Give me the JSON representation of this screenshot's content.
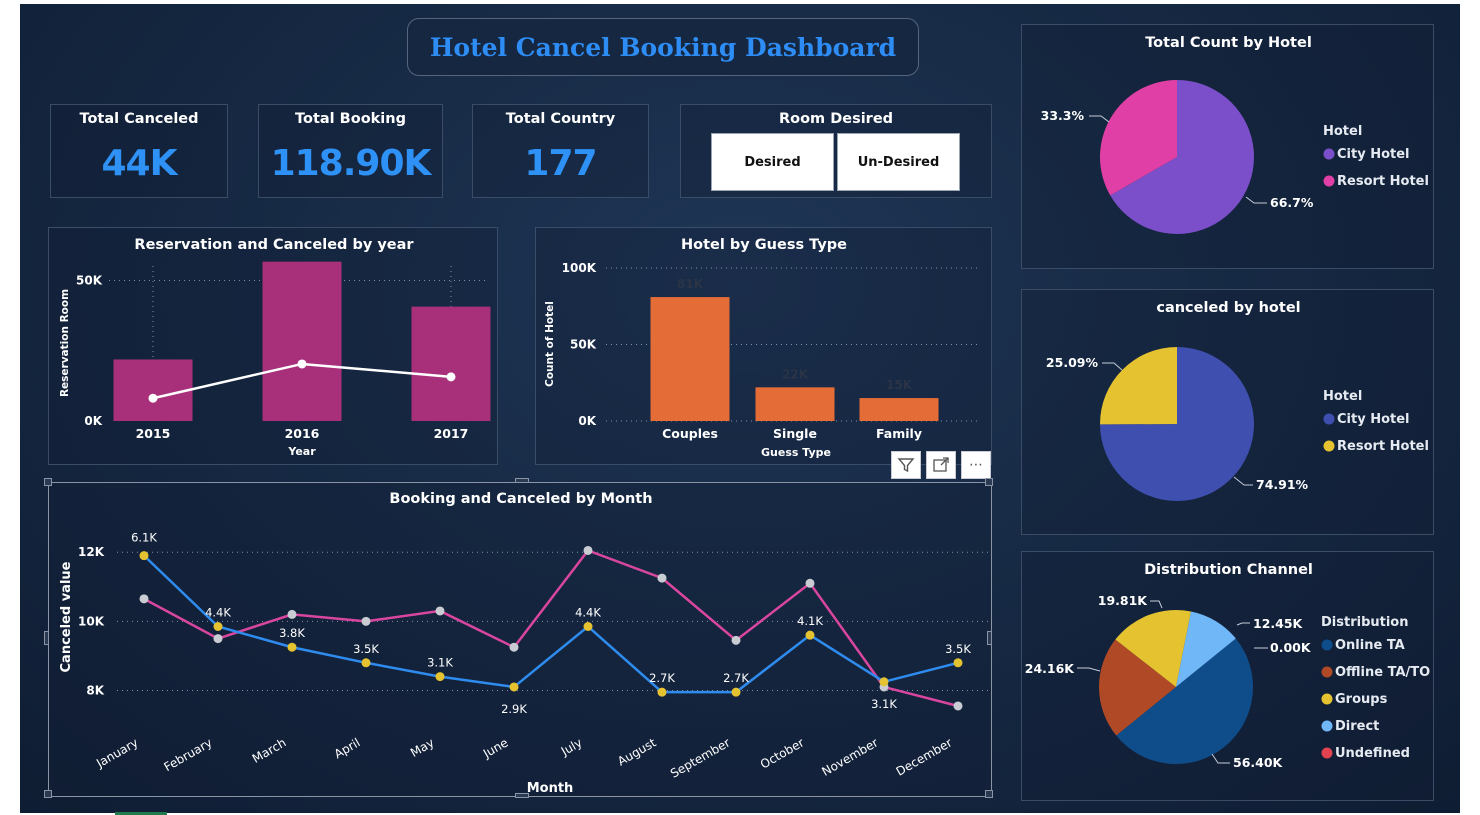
{
  "dashboard": {
    "title": "Hotel Cancel Booking Dashboard"
  },
  "kpis": [
    {
      "label": "Total Canceled",
      "value": "44K"
    },
    {
      "label": "Total Booking",
      "value": "118.90K"
    },
    {
      "label": "Total Country",
      "value": "177"
    }
  ],
  "room_desired": {
    "label": "Room Desired",
    "options": [
      "Desired",
      "Un-Desired"
    ]
  },
  "visual_toolbar": {
    "filter_icon": "filter-icon",
    "focus_icon": "focus-mode-icon",
    "more_icon": "more-options-icon",
    "more_glyph": "⋯"
  },
  "colors": {
    "accent_blue": "#2e91f5",
    "bar_magenta": "#a8307a",
    "bar_orange": "#e46c36",
    "city_hotel": "#7b4fc9",
    "resort_hotel": "#e040a6",
    "canceled_city": "#3f4fb0",
    "canceled_resort": "#e5c230",
    "line_blue": "#2f8cef",
    "line_pink": "#d9469f",
    "dist_online": "#0f4c8a",
    "dist_offline": "#b04a26",
    "dist_groups": "#e5c230",
    "dist_direct": "#6fb7f7",
    "dist_undefined": "#e0424f"
  },
  "chart_data": [
    {
      "id": "reservation_by_year",
      "type": "bar",
      "title": "Reservation and Canceled by year",
      "xlabel": "Year",
      "ylabel": "Reservation Room",
      "categories": [
        "2015",
        "2016",
        "2017"
      ],
      "series": [
        {
          "values": [
            21900,
            56700,
            40700
          ]
        },
        {
          "values": [
            8100,
            20300,
            15700
          ]
        }
      ],
      "ylim": [
        0,
        58000
      ],
      "yticks": [
        {
          "value": 0,
          "label": "0K"
        },
        {
          "value": 50000,
          "label": "50K"
        }
      ]
    },
    {
      "id": "hotel_by_guest_type",
      "type": "bar",
      "title": "Hotel by Guess Type",
      "xlabel": "Guess Type",
      "ylabel": "Count of Hotel",
      "categories": [
        "Couples",
        "Single",
        "Family"
      ],
      "values": [
        81000,
        22000,
        15000
      ],
      "data_labels": [
        "81K",
        "22K",
        "15K"
      ],
      "ylim": [
        0,
        100000
      ],
      "yticks": [
        {
          "value": 0,
          "label": "0K"
        },
        {
          "value": 50000,
          "label": "50K"
        },
        {
          "value": 100000,
          "label": "100K"
        }
      ]
    },
    {
      "id": "booking_canceled_by_month",
      "type": "line",
      "title": "Booking and Canceled by Month",
      "xlabel": "Month",
      "ylabel": "Canceled value",
      "categories": [
        "January",
        "February",
        "March",
        "April",
        "May",
        "June",
        "July",
        "August",
        "September",
        "October",
        "November",
        "December"
      ],
      "series": [
        {
          "values": [
            11900,
            9850,
            9250,
            8800,
            8400,
            8100,
            9850,
            7950,
            7950,
            9600,
            8250,
            8800
          ],
          "data_labels": [
            "6.1K",
            "4.4K",
            "3.8K",
            "3.5K",
            "3.1K",
            "2.9K",
            "4.4K",
            "2.7K",
            "2.7K",
            "4.1K",
            "3.1K",
            "3.5K"
          ]
        },
        {
          "values": [
            10650,
            9500,
            10200,
            10000,
            10300,
            9250,
            12050,
            11250,
            9450,
            11100,
            8100,
            7550
          ]
        }
      ],
      "ylim": [
        7000,
        12700
      ],
      "yticks": [
        {
          "value": 8000,
          "label": "8K"
        },
        {
          "value": 10000,
          "label": "10K"
        },
        {
          "value": 12000,
          "label": "12K"
        }
      ]
    },
    {
      "id": "total_count_by_hotel",
      "type": "pie",
      "title": "Total Count by Hotel",
      "legend_title": "Hotel",
      "slices": [
        {
          "label": "City Hotel",
          "value": 66.7,
          "display": "66.7%"
        },
        {
          "label": "Resort Hotel",
          "value": 33.3,
          "display": "33.3%"
        }
      ],
      "legend_position": "right"
    },
    {
      "id": "canceled_by_hotel",
      "type": "pie",
      "title": "canceled by hotel",
      "legend_title": "Hotel",
      "slices": [
        {
          "label": "City Hotel",
          "value": 74.91,
          "display": "74.91%"
        },
        {
          "label": "Resort Hotel",
          "value": 25.09,
          "display": "25.09%"
        }
      ],
      "legend_position": "right"
    },
    {
      "id": "distribution_channel",
      "type": "pie",
      "title": "Distribution Channel",
      "legend_title": "Distribution",
      "slices": [
        {
          "label": "Online TA",
          "value": 56.4,
          "display": "56.40K"
        },
        {
          "label": "Offline TA/TO",
          "value": 24.16,
          "display": "24.16K"
        },
        {
          "label": "Groups",
          "value": 19.81,
          "display": "19.81K"
        },
        {
          "label": "Direct",
          "value": 12.45,
          "display": "12.45K"
        },
        {
          "label": "Undefined",
          "value": 0.004,
          "display": "0.00K"
        }
      ],
      "legend_position": "right"
    }
  ]
}
